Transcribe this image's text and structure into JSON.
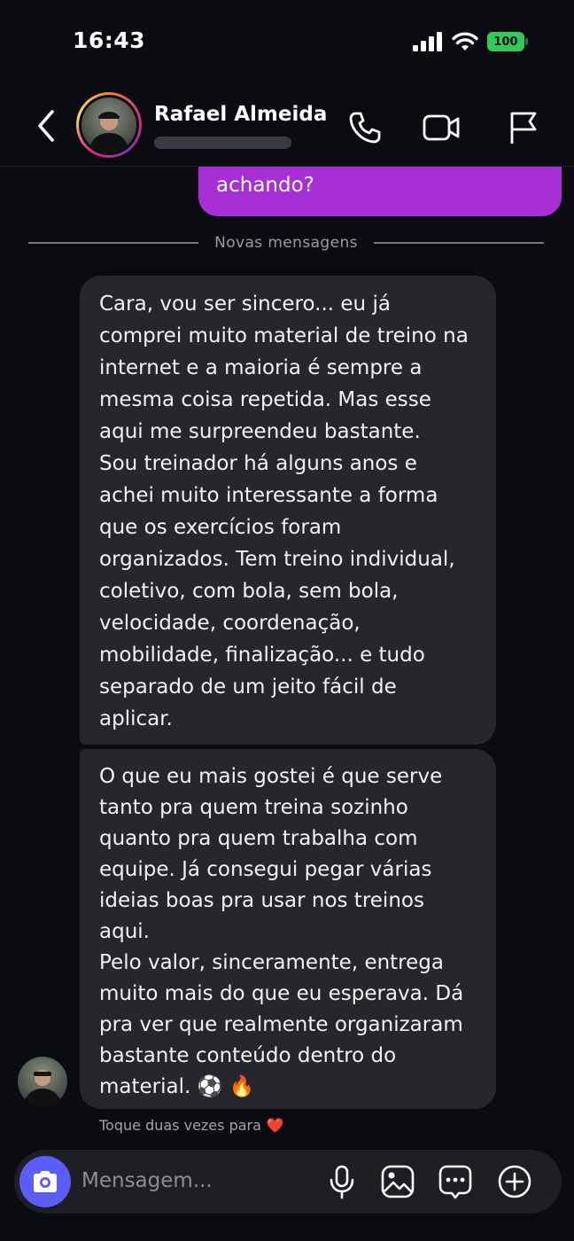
{
  "status_bar": {
    "time": "16:43",
    "battery": "100"
  },
  "header": {
    "contact_name": "Rafael Almeida",
    "icons": [
      "back-icon",
      "phone-icon",
      "video-icon",
      "flag-icon"
    ]
  },
  "messages": {
    "sent_partial": "achando?",
    "divider": "Novas mensagens",
    "received": [
      "Cara, vou ser sincero... eu já\ncomprei muito material de treino na\ninternet e a maioria é sempre a\nmesma coisa repetida. Mas esse\naqui me surpreendeu bastante.\nSou treinador há alguns anos e\nachei muito interessante a forma\nque os exercícios foram\norganizados. Tem treino individual,\ncoletivo, com bola, sem bola,\nvelocidade, coordenação,\nmobilidade, finalização... e tudo\nseparado de um jeito fácil de\naplicar.",
      "O que eu mais gostei é que serve\ntanto pra quem treina sozinho\nquanto pra quem trabalha com\nequipe. Já consegui pegar várias\nideias boas pra usar nos treinos\naqui.\nPelo valor, sinceramente, entrega\nmuito mais do que eu esperava. Dá\npra ver que realmente organizaram\nbastante conteúdo dentro do\nmaterial. ⚽ 🔥"
    ],
    "hint": "Toque duas vezes para",
    "hint_emoji": "❤️"
  },
  "composer": {
    "placeholder": "Mensagem...",
    "icons": [
      "camera-icon",
      "microphone-icon",
      "gallery-icon",
      "sticker-icon",
      "add-icon"
    ]
  },
  "colors": {
    "background": "#0b0b12",
    "sent_bubble": "#a630d6",
    "received_bubble": "#26262d",
    "camera_button": "#5b5ef6",
    "battery": "#34c759"
  }
}
